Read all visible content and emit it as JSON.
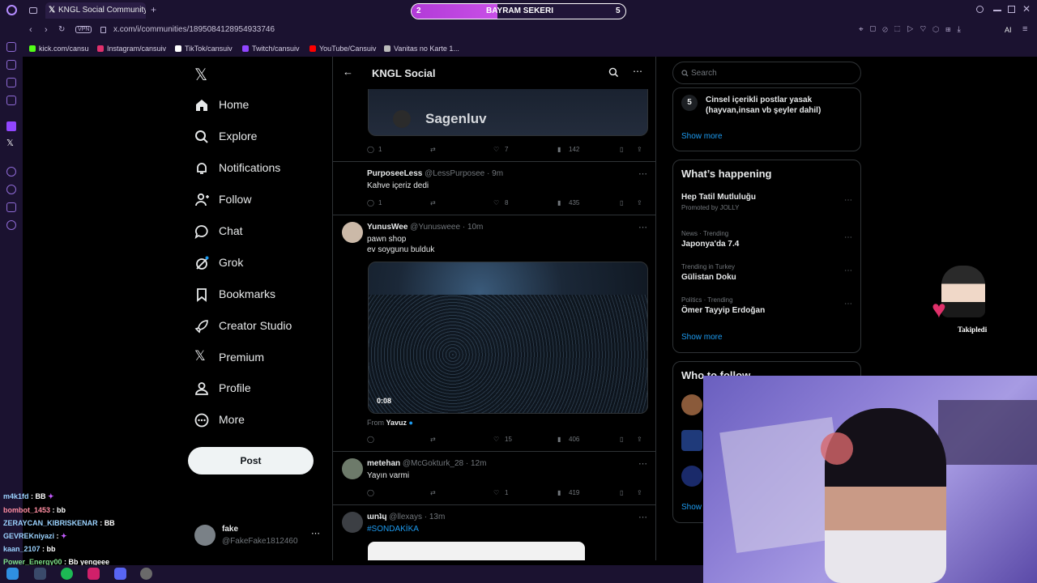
{
  "browser": {
    "tab_title": "KNGL Social Community /",
    "vpn_label": "VPN",
    "url": "x.com/i/communities/1895084128954933746",
    "bookmarks": [
      {
        "label": "kick.com/cansu",
        "color": "#53fc18"
      },
      {
        "label": "Instagram/cansuiv",
        "color": "#e1306c"
      },
      {
        "label": "TikTok/cansuiv",
        "color": "#ffffff"
      },
      {
        "label": "Twitch/cansuiv",
        "color": "#9146ff"
      },
      {
        "label": "YouTube/Cansuiv",
        "color": "#ff0000"
      },
      {
        "label": "Vanitas no Karte 1...",
        "color": "#bbbbbb"
      }
    ],
    "ai_label": "AI"
  },
  "overlay": {
    "left_num": "2",
    "title": "BAYRAM SEKERI",
    "right_num": "5",
    "progress": 0.4
  },
  "nav": {
    "items": [
      {
        "label": "Home",
        "icon": "home-icon"
      },
      {
        "label": "Explore",
        "icon": "search-icon"
      },
      {
        "label": "Notifications",
        "icon": "bell-icon"
      },
      {
        "label": "Follow",
        "icon": "follow-icon"
      },
      {
        "label": "Chat",
        "icon": "chat-icon"
      },
      {
        "label": "Grok",
        "icon": "grok-icon"
      },
      {
        "label": "Bookmarks",
        "icon": "bookmark-icon"
      },
      {
        "label": "Creator Studio",
        "icon": "rocket-icon"
      },
      {
        "label": "Premium",
        "icon": "x-logo-icon"
      },
      {
        "label": "Profile",
        "icon": "person-icon"
      },
      {
        "label": "More",
        "icon": "more-icon"
      }
    ],
    "post_label": "Post",
    "account": {
      "name": "fake",
      "handle": "@FakeFake1812460"
    }
  },
  "community": {
    "title": "KNGL Social",
    "image_text": "Sagenluv",
    "tweets": [
      {
        "stats": {
          "replies": "1",
          "likes": "7",
          "views": "142"
        }
      },
      {
        "name": "PurposeeLess",
        "handle": "@LessPurposee",
        "time": "9m",
        "text": "Kahve içeriz dedi",
        "stats": {
          "replies": "1",
          "likes": "8",
          "views": "435"
        }
      },
      {
        "name": "YunusWee",
        "handle": "@Yunusweee",
        "time": "10m",
        "text1": "pawn shop",
        "text2": "ev soygunu bulduk",
        "video_time": "0:08",
        "from_label": "From",
        "from_name": "Yavuz",
        "stats": {
          "replies": "",
          "likes": "15",
          "views": "406"
        }
      },
      {
        "name": "metehan",
        "handle": "@McGokturk_28",
        "time": "12m",
        "text": "Yayın varmi",
        "stats": {
          "replies": "",
          "likes": "1",
          "views": "419"
        }
      },
      {
        "name": "ɯnʇɥ",
        "handle": "@llexays",
        "time": "13m",
        "text": "#SONDAKİKA"
      }
    ]
  },
  "right": {
    "search_placeholder": "Search",
    "rule": {
      "num": "5",
      "text1": "Cinsel içerikli postlar yasak",
      "text2": "(hayvan,insan vb şeyler dahil)"
    },
    "show_more": "Show more",
    "happening_title": "What’s happening",
    "trends": [
      {
        "context": "",
        "title": "Hep Tatil Mutluluğu",
        "sub": "Promoted by JOLLY"
      },
      {
        "context": "News · Trending",
        "title": "Japonya'da 7.4",
        "sub": ""
      },
      {
        "context": "Trending in Turkey",
        "title": "Gülistan Doku",
        "sub": ""
      },
      {
        "context": "Politics · Trending",
        "title": "Ömer Tayyip Erdoğan",
        "sub": ""
      }
    ],
    "who_to_follow": "Who to follow",
    "show": "Show"
  },
  "overlay_follow": {
    "label": "Takipledi"
  },
  "chat": [
    {
      "user": "m4k1fd",
      "msg": "BB"
    },
    {
      "user": "bombot_1453",
      "msg": "bb"
    },
    {
      "user": "ZERAYCAN_KIBRISKENAR",
      "msg": "BB"
    },
    {
      "user": "GEVREKniyazi",
      "msg": ""
    },
    {
      "user": "kaan_2107",
      "msg": "bb"
    },
    {
      "user": "Power_Energy00",
      "msg": "Bb yengeee"
    }
  ],
  "colors": {
    "accent": "#1d9bf0",
    "brand": "#9146ff"
  }
}
